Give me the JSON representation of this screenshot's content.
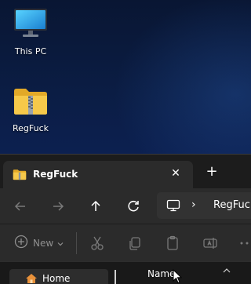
{
  "desktop": {
    "icons": [
      {
        "label": "This PC",
        "icon": "monitor-icon"
      },
      {
        "label": "RegFuck",
        "icon": "zip-folder-icon"
      }
    ]
  },
  "explorer": {
    "tab": {
      "title": "RegFuck",
      "icon": "zip-folder-icon",
      "close_symbol": "✕"
    },
    "new_tab_symbol": "+",
    "nav": {
      "back_icon": "arrow-left-icon",
      "forward_icon": "arrow-right-icon",
      "up_icon": "arrow-up-icon",
      "refresh_icon": "refresh-icon"
    },
    "address": {
      "separator": "›",
      "crumb": "RegFuck",
      "root_icon": "monitor-icon"
    },
    "toolbar": {
      "new_label": "New",
      "buttons": [
        "cut-icon",
        "copy-icon",
        "paste-icon",
        "rename-icon"
      ]
    },
    "sidebar": {
      "items": [
        {
          "label": "Home",
          "icon": "home-icon"
        }
      ]
    },
    "columns": [
      "Name"
    ]
  },
  "colors": {
    "desktop_bg": "#0b1d44",
    "window_bg": "#1c1c1c",
    "panel_bg": "#2b2b2b",
    "folder_yellow": "#f6c94a",
    "disabled_text": "#8f8f8f"
  }
}
